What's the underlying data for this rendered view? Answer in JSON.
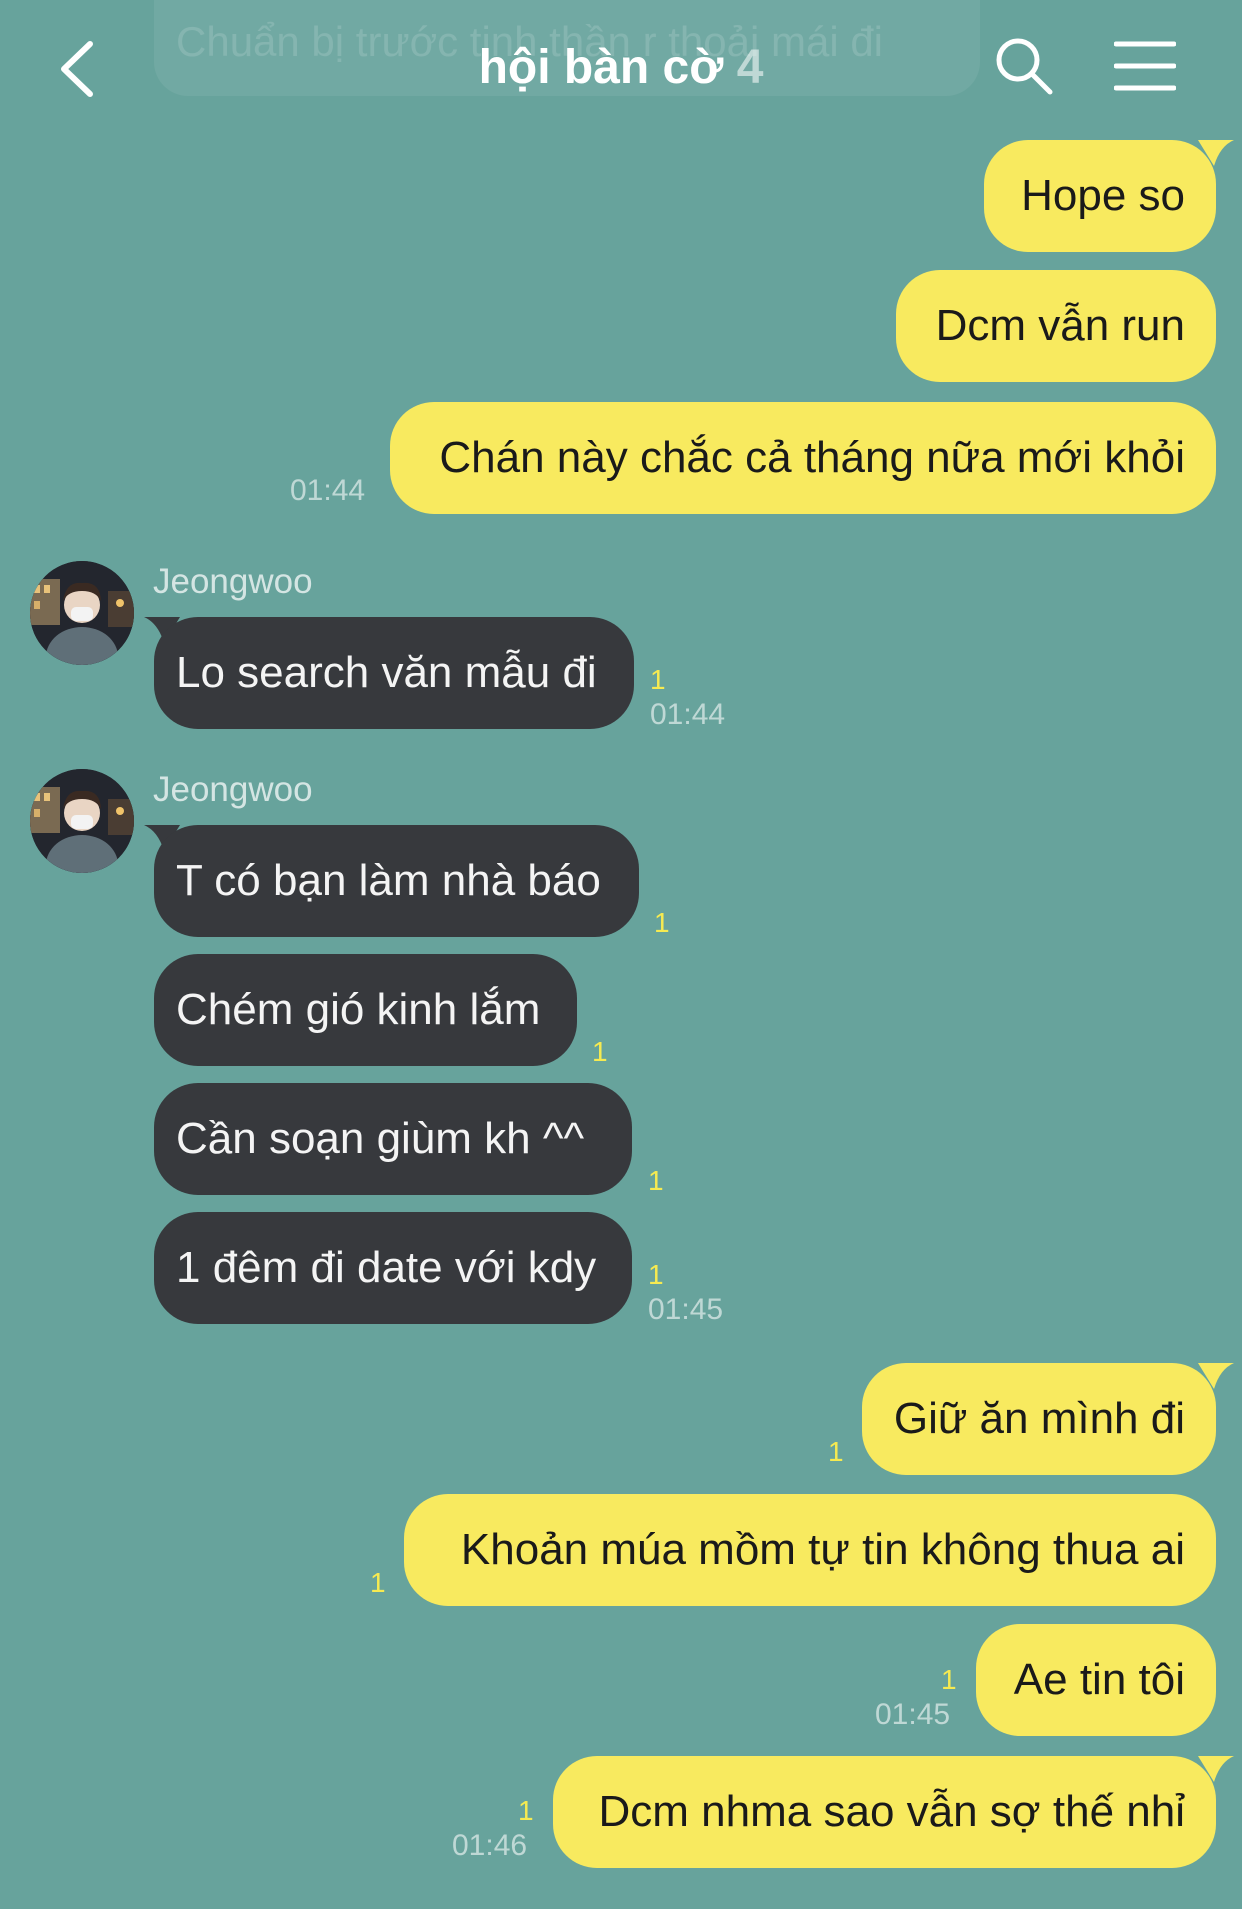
{
  "header": {
    "pinned_notice": "Chuẩn bị trước tinh thần r thoải mái đi",
    "title": "hội bàn cờ",
    "member_count": "4",
    "icons": [
      "back-icon",
      "search-icon",
      "menu-icon"
    ]
  },
  "colors": {
    "background": "#67a39c",
    "outgoing_bubble": "#f8ea5f",
    "incoming_bubble": "#37393d",
    "unread": "#f6ea51"
  },
  "messages": [
    {
      "id": "m1",
      "from": "me",
      "text": "Hope so"
    },
    {
      "id": "m2",
      "from": "me",
      "text": "Dcm vẫn run"
    },
    {
      "id": "m3",
      "from": "me",
      "text": "Chán này chắc cả tháng nữa mới khỏi",
      "time": "01:44"
    },
    {
      "id": "m4",
      "from": "Jeongwoo",
      "text": "Lo search văn mẫu đi",
      "unread": "1",
      "time": "01:44"
    },
    {
      "id": "m5",
      "from": "Jeongwoo",
      "text": "T có bạn làm nhà báo",
      "unread": "1"
    },
    {
      "id": "m6",
      "from": "Jeongwoo",
      "text": "Chém gió kinh lắm",
      "unread": "1"
    },
    {
      "id": "m7",
      "from": "Jeongwoo",
      "text": "Cần soạn giùm kh ^^",
      "unread": "1"
    },
    {
      "id": "m8",
      "from": "Jeongwoo",
      "text": "1 đêm đi date với kdy",
      "unread": "1",
      "time": "01:45"
    },
    {
      "id": "m9",
      "from": "me",
      "text": "Giữ ăn mình đi",
      "unread": "1"
    },
    {
      "id": "m10",
      "from": "me",
      "text": "Khoản múa mồm tự tin không thua ai",
      "unread": "1"
    },
    {
      "id": "m11",
      "from": "me",
      "text": "Ae tin tôi",
      "unread": "1",
      "time": "01:45"
    },
    {
      "id": "m12",
      "from": "me",
      "text": "Dcm nhma sao vẫn sợ thế nhỉ",
      "unread": "1",
      "time": "01:46"
    }
  ],
  "senders": {
    "g1": "Jeongwoo",
    "g2": "Jeongwoo"
  }
}
